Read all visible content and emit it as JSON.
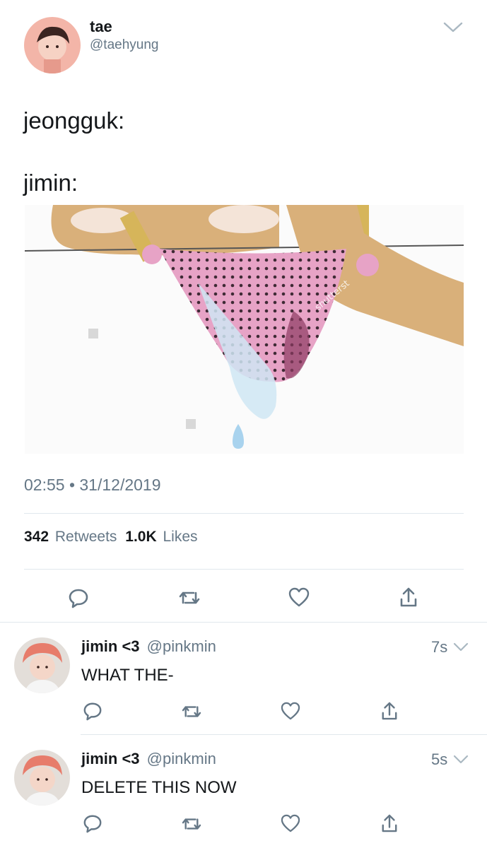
{
  "tweet": {
    "author_name": "tae",
    "author_handle": "@taehyung",
    "line1": "jeongguk:",
    "line2": "jimin:",
    "timestamp": "02:55 • 31/12/2019",
    "retweet_count": "342",
    "retweet_label": "Retweets",
    "like_count": "1.0K",
    "like_label": "Likes",
    "image_watermark": "shutterst"
  },
  "replies": [
    {
      "name": "jimin <3",
      "handle": "@pinkmin",
      "time": "7s",
      "text": "WHAT THE-"
    },
    {
      "name": "jimin <3",
      "handle": "@pinkmin",
      "time": "5s",
      "text": "DELETE THIS NOW"
    }
  ],
  "colors": {
    "text_primary": "#14171a",
    "text_secondary": "#657786",
    "icon": "#657786",
    "divider": "#e1e8ed"
  },
  "icons": [
    "chevron-down-icon",
    "reply-icon",
    "retweet-icon",
    "like-icon",
    "share-icon"
  ]
}
